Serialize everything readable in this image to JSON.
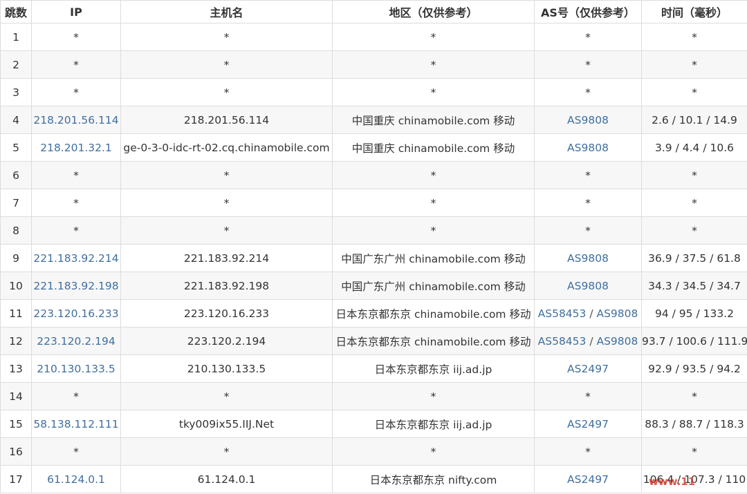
{
  "headers": {
    "hop": "跳数",
    "ip": "IP",
    "hostname": "主机名",
    "region": "地区（仅供参考）",
    "as": "AS号（仅供参考）",
    "time": "时间（毫秒）"
  },
  "rows": [
    {
      "hop": "1",
      "ip": "*",
      "host": "*",
      "region": "*",
      "as": [
        "*"
      ],
      "time": "*"
    },
    {
      "hop": "2",
      "ip": "*",
      "host": "*",
      "region": "*",
      "as": [
        "*"
      ],
      "time": "*"
    },
    {
      "hop": "3",
      "ip": "*",
      "host": "*",
      "region": "*",
      "as": [
        "*"
      ],
      "time": "*"
    },
    {
      "hop": "4",
      "ip": "218.201.56.114",
      "host": "218.201.56.114",
      "region": "中国重庆 chinamobile.com 移动",
      "as": [
        "AS9808"
      ],
      "time": "2.6 / 10.1 / 14.9"
    },
    {
      "hop": "5",
      "ip": "218.201.32.1",
      "host": "ge-0-3-0-idc-rt-02.cq.chinamobile.com",
      "region": "中国重庆 chinamobile.com 移动",
      "as": [
        "AS9808"
      ],
      "time": "3.9 / 4.4 / 10.6"
    },
    {
      "hop": "6",
      "ip": "*",
      "host": "*",
      "region": "*",
      "as": [
        "*"
      ],
      "time": "*"
    },
    {
      "hop": "7",
      "ip": "*",
      "host": "*",
      "region": "*",
      "as": [
        "*"
      ],
      "time": "*"
    },
    {
      "hop": "8",
      "ip": "*",
      "host": "*",
      "region": "*",
      "as": [
        "*"
      ],
      "time": "*"
    },
    {
      "hop": "9",
      "ip": "221.183.92.214",
      "host": "221.183.92.214",
      "region": "中国广东广州 chinamobile.com 移动",
      "as": [
        "AS9808"
      ],
      "time": "36.9 / 37.5 / 61.8"
    },
    {
      "hop": "10",
      "ip": "221.183.92.198",
      "host": "221.183.92.198",
      "region": "中国广东广州 chinamobile.com 移动",
      "as": [
        "AS9808"
      ],
      "time": "34.3 / 34.5 / 34.7"
    },
    {
      "hop": "11",
      "ip": "223.120.16.233",
      "host": "223.120.16.233",
      "region": "日本东京都东京 chinamobile.com 移动",
      "as": [
        "AS58453",
        "AS9808"
      ],
      "time": "94 / 95 / 133.2"
    },
    {
      "hop": "12",
      "ip": "223.120.2.194",
      "host": "223.120.2.194",
      "region": "日本东京都东京 chinamobile.com 移动",
      "as": [
        "AS58453",
        "AS9808"
      ],
      "time": "93.7 / 100.6 / 111.9"
    },
    {
      "hop": "13",
      "ip": "210.130.133.5",
      "host": "210.130.133.5",
      "region": "日本东京都东京 iij.ad.jp",
      "as": [
        "AS2497"
      ],
      "time": "92.9 / 93.5 / 94.2"
    },
    {
      "hop": "14",
      "ip": "*",
      "host": "*",
      "region": "*",
      "as": [
        "*"
      ],
      "time": "*"
    },
    {
      "hop": "15",
      "ip": "58.138.112.111",
      "host": "tky009ix55.IIJ.Net",
      "region": "日本东京都东京 iij.ad.jp",
      "as": [
        "AS2497"
      ],
      "time": "88.3 / 88.7 / 118.3"
    },
    {
      "hop": "16",
      "ip": "*",
      "host": "*",
      "region": "*",
      "as": [
        "*"
      ],
      "time": "*"
    },
    {
      "hop": "17",
      "ip": "61.124.0.1",
      "host": "61.124.0.1",
      "region": "日本东京都东京 nifty.com",
      "as": [
        "AS2497"
      ],
      "time": "106.4 / 107.3 / 110"
    }
  ],
  "as_separator": " / ",
  "watermark": "www.11",
  "colors": {
    "link": "#3f6f9f",
    "text": "#333333",
    "border": "#dcdcdc",
    "stripe": "#f7f7f7",
    "watermark": "#d9301f"
  }
}
